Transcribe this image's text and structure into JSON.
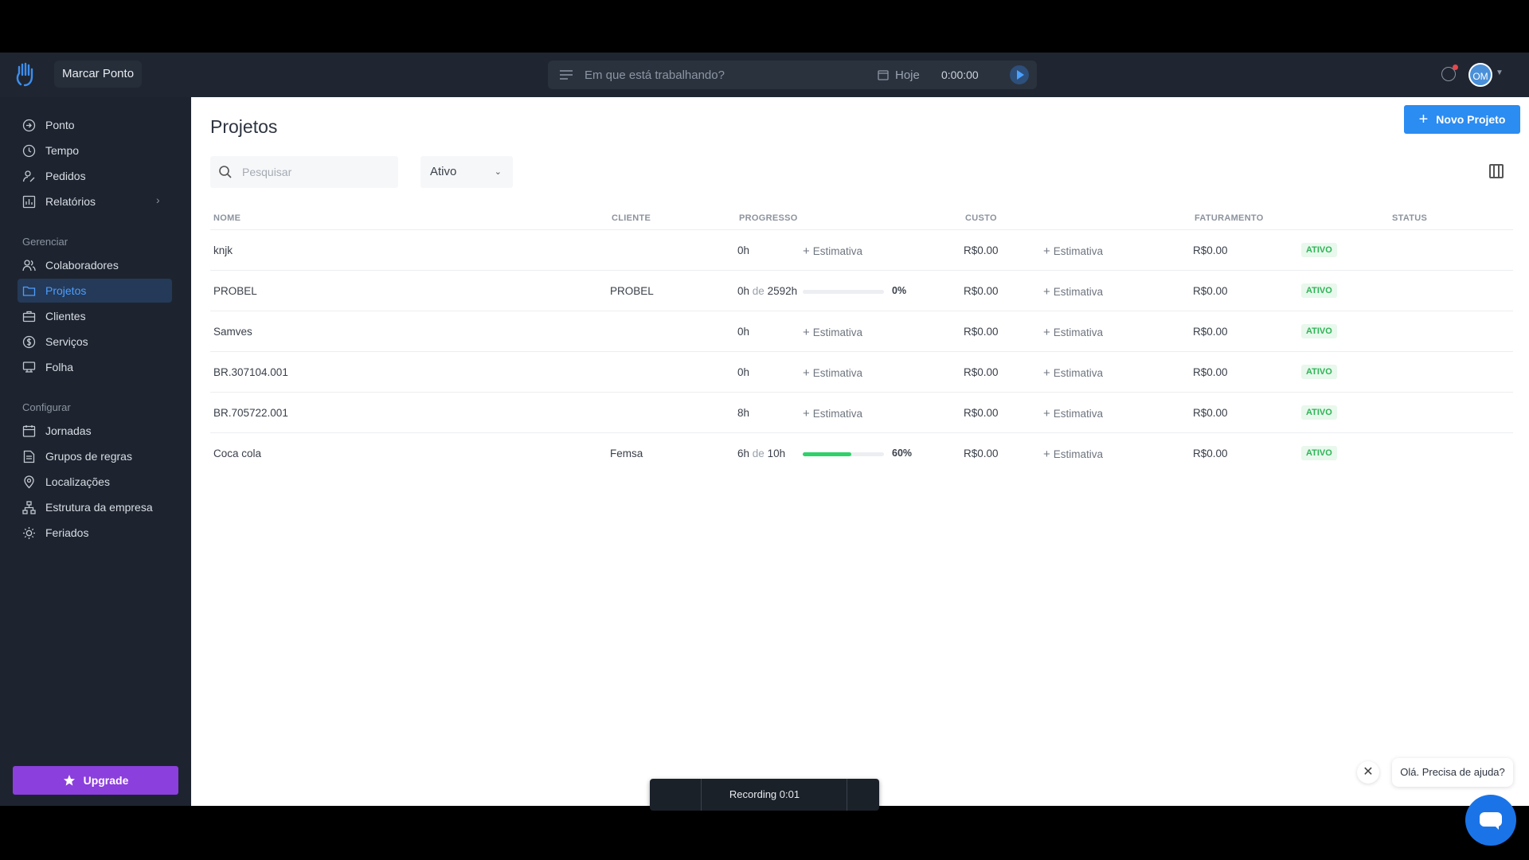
{
  "topbar": {
    "marcar_ponto": "Marcar Ponto",
    "description_placeholder": "Em que está trabalhando?",
    "date_label": "Hoje",
    "timer": "0:00:00",
    "avatar_initials": "OM"
  },
  "sidebar": {
    "items": [
      {
        "label": "Ponto",
        "icon": "login-arrow-icon"
      },
      {
        "label": "Tempo",
        "icon": "clock-icon"
      },
      {
        "label": "Pedidos",
        "icon": "person-request-icon"
      },
      {
        "label": "Relatórios",
        "icon": "bar-chart-icon"
      }
    ],
    "section_manage": "Gerenciar",
    "manage_items": [
      {
        "label": "Colaboradores",
        "icon": "people-icon"
      },
      {
        "label": "Projetos",
        "icon": "folder-icon",
        "active": true
      },
      {
        "label": "Clientes",
        "icon": "briefcase-icon"
      },
      {
        "label": "Serviços",
        "icon": "dollar-circle-icon"
      },
      {
        "label": "Folha",
        "icon": "payroll-icon"
      }
    ],
    "section_config": "Configurar",
    "config_items": [
      {
        "label": "Jornadas",
        "icon": "calendar-icon"
      },
      {
        "label": "Grupos de regras",
        "icon": "rules-icon"
      },
      {
        "label": "Localizações",
        "icon": "location-pin-icon"
      },
      {
        "label": "Estrutura da empresa",
        "icon": "org-chart-icon"
      },
      {
        "label": "Feriados",
        "icon": "sun-icon"
      }
    ],
    "upgrade": "Upgrade"
  },
  "main": {
    "title": "Projetos",
    "new_project": "Novo Projeto",
    "search_placeholder": "Pesquisar",
    "status_filter": "Ativo",
    "columns": {
      "nome": "NOME",
      "cliente": "CLIENTE",
      "progresso": "PROGRESSO",
      "custo": "CUSTO",
      "faturamento": "FATURAMENTO",
      "status": "STATUS"
    },
    "estimate_label": "Estimativa",
    "of_label": "de",
    "rows": [
      {
        "nome": "knjk",
        "cliente": "",
        "horas": "0h",
        "total": "",
        "pct": null,
        "pct_label": "",
        "custo": "R$0.00",
        "faturamento": "R$0.00",
        "status": "ATIVO"
      },
      {
        "nome": "PROBEL",
        "cliente": "PROBEL",
        "horas": "0h",
        "total": "2592h",
        "pct": 0,
        "pct_label": "0%",
        "custo": "R$0.00",
        "faturamento": "R$0.00",
        "status": "ATIVO"
      },
      {
        "nome": "Samves",
        "cliente": "",
        "horas": "0h",
        "total": "",
        "pct": null,
        "pct_label": "",
        "custo": "R$0.00",
        "faturamento": "R$0.00",
        "status": "ATIVO"
      },
      {
        "nome": "BR.307104.001",
        "cliente": "",
        "horas": "0h",
        "total": "",
        "pct": null,
        "pct_label": "",
        "custo": "R$0.00",
        "faturamento": "R$0.00",
        "status": "ATIVO"
      },
      {
        "nome": "BR.705722.001",
        "cliente": "",
        "horas": "8h",
        "total": "",
        "pct": null,
        "pct_label": "",
        "custo": "R$0.00",
        "faturamento": "R$0.00",
        "status": "ATIVO"
      },
      {
        "nome": "Coca cola",
        "cliente": "Femsa",
        "horas": "6h",
        "total": "10h",
        "pct": 60,
        "pct_label": "60%",
        "custo": "R$0.00",
        "faturamento": "R$0.00",
        "status": "ATIVO"
      }
    ]
  },
  "overlay": {
    "recording": "Recording 0:01",
    "chat_prompt": "Olá. Precisa de ajuda?"
  },
  "colors": {
    "accent": "#2b8cf1",
    "upgrade": "#8b3fdc",
    "progress": "#2ed16a",
    "status_green": "#2eb356"
  }
}
